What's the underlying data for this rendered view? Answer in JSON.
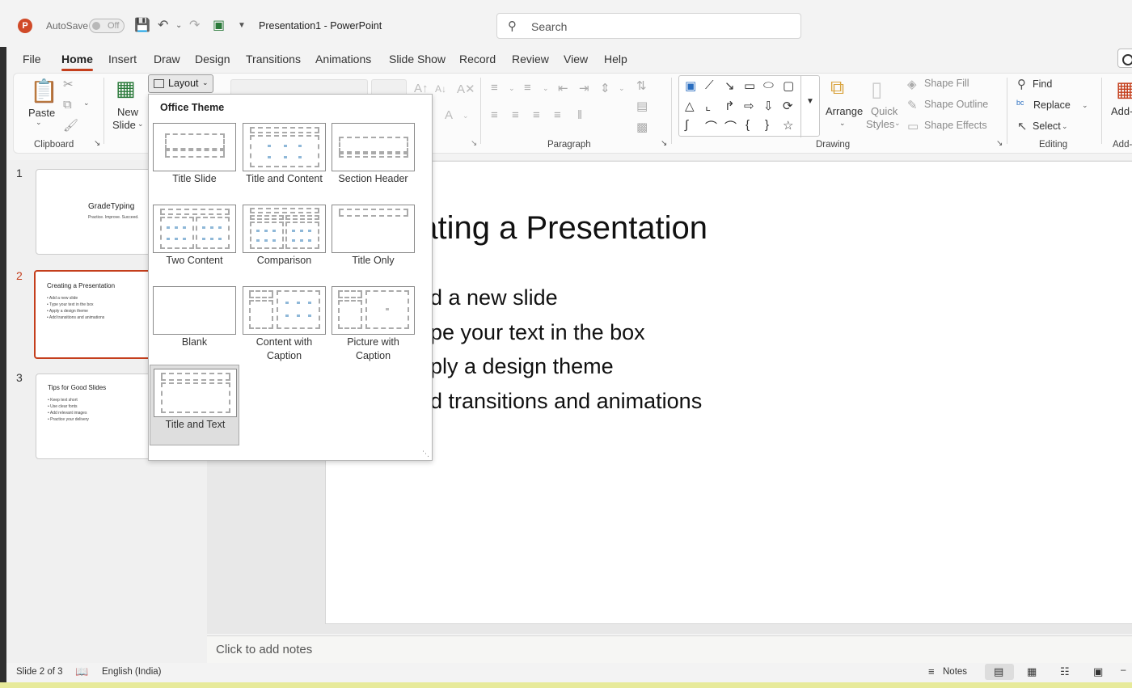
{
  "titlebar": {
    "autosave_label": "AutoSave",
    "autosave_state": "Off",
    "doc_title": "Presentation1  -  PowerPoint",
    "search_placeholder": "Search"
  },
  "tabs": [
    "File",
    "Home",
    "Insert",
    "Draw",
    "Design",
    "Transitions",
    "Animations",
    "Slide Show",
    "Record",
    "Review",
    "View",
    "Help"
  ],
  "active_tab": "Home",
  "ribbon": {
    "clipboard": {
      "label": "Clipboard",
      "paste": "Paste"
    },
    "slides": {
      "new_slide_1": "New",
      "new_slide_2": "Slide",
      "layout": "Layout"
    },
    "paragraph": {
      "label": "Paragraph"
    },
    "drawing": {
      "label": "Drawing",
      "arrange": "Arrange",
      "quick_styles_1": "Quick",
      "quick_styles_2": "Styles",
      "shape_fill": "Shape Fill",
      "shape_outline": "Shape Outline",
      "shape_effects": "Shape Effects"
    },
    "editing": {
      "label": "Editing",
      "find": "Find",
      "replace": "Replace",
      "select": "Select"
    },
    "addins": {
      "label": "Add-",
      "label2": "Add-"
    }
  },
  "layout_menu": {
    "header": "Office Theme",
    "items": [
      {
        "name": "Title Slide"
      },
      {
        "name": "Title and Content"
      },
      {
        "name": "Section Header"
      },
      {
        "name": "Two Content"
      },
      {
        "name": "Comparison"
      },
      {
        "name": "Title Only"
      },
      {
        "name": "Blank"
      },
      {
        "name": "Content with Caption"
      },
      {
        "name": "Picture with Caption"
      },
      {
        "name": "Title and Text"
      }
    ]
  },
  "slides": [
    {
      "number": "1",
      "title": "GradeTyping",
      "subtitle": "Practice. Improve. Succeed."
    },
    {
      "number": "2",
      "title": "Creating a Presentation",
      "bullets": [
        "Add a new slide",
        "Type your text in the box",
        "Apply a design theme",
        "Add transitions and animations"
      ]
    },
    {
      "number": "3",
      "title": "Tips for Good Slides",
      "bullets": [
        "Keep text short",
        "Use clear fonts",
        "Add relevant images",
        "Practice your delivery"
      ]
    }
  ],
  "current_slide": {
    "title_visible": "eating a Presentation",
    "bullets_visible": [
      "d a new slide",
      "pe your text in the box",
      "ply a design theme",
      "d transitions and animations"
    ]
  },
  "notes_placeholder": "Click to add notes",
  "status": {
    "slide_counter": "Slide 2 of 3",
    "language": "English (India)",
    "notes_label": "Notes"
  },
  "colors": {
    "accent": "#c43e1c",
    "app_icon": "#d04a28"
  }
}
